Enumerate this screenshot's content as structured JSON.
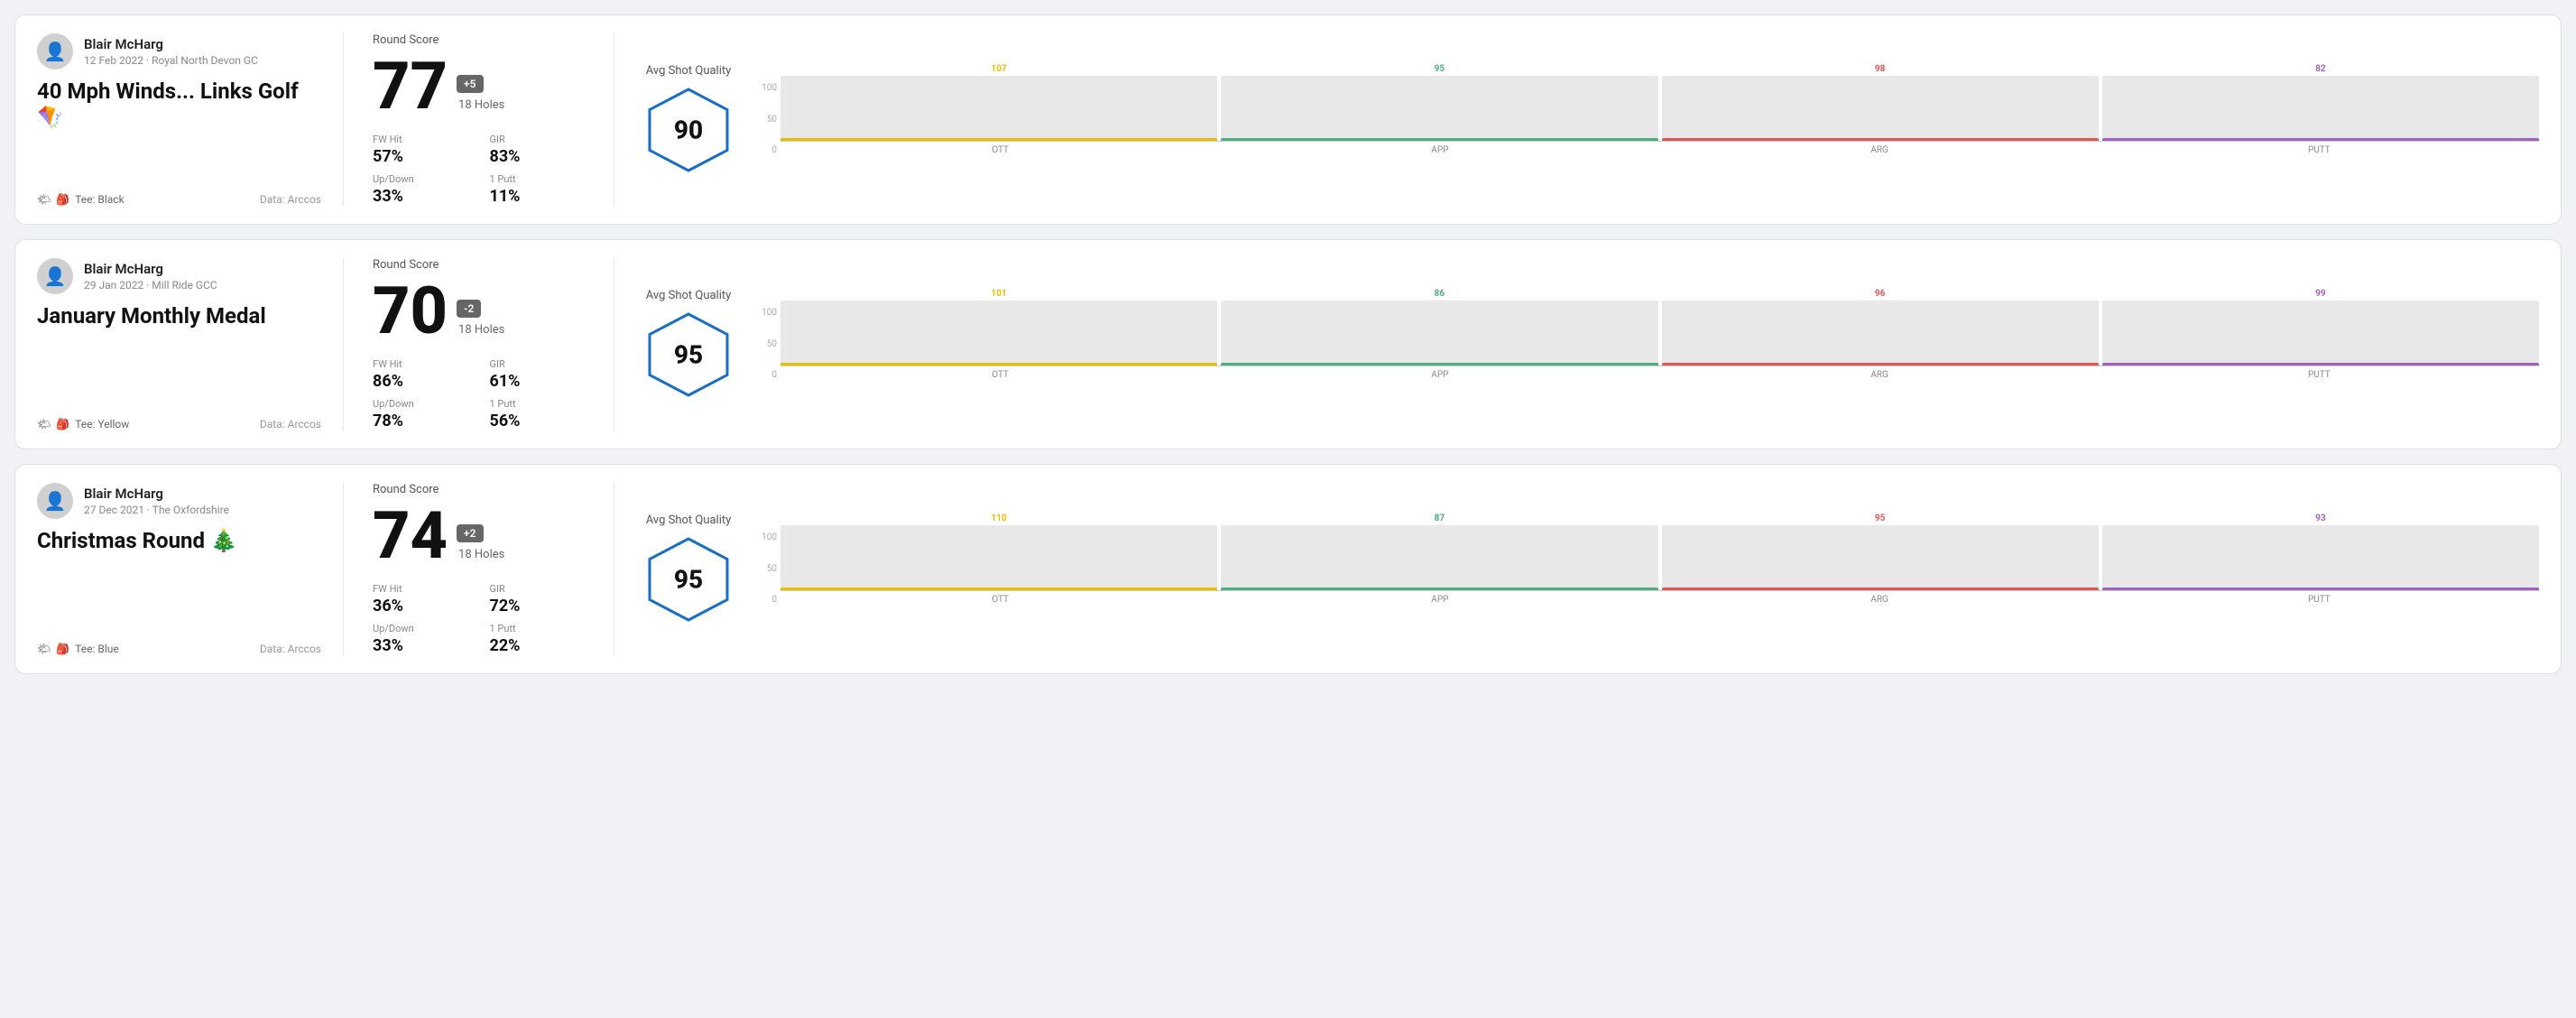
{
  "rounds": [
    {
      "id": "round1",
      "player_name": "Blair McHarg",
      "date_course": "12 Feb 2022 · Royal North Devon GC",
      "title": "40 Mph Winds... Links Golf 🪁",
      "tee": "Black",
      "data_source": "Data: Arccos",
      "round_score_label": "Round Score",
      "score": "77",
      "score_diff": "+5",
      "holes": "18 Holes",
      "fw_hit_label": "FW Hit",
      "fw_hit_value": "57%",
      "gir_label": "GIR",
      "gir_value": "83%",
      "updown_label": "Up/Down",
      "updown_value": "33%",
      "oneputt_label": "1 Putt",
      "oneputt_value": "11%",
      "avg_shot_quality_label": "Avg Shot Quality",
      "quality_score": "90",
      "chart": {
        "ott": {
          "value": 107,
          "color": "#e6c000",
          "height_pct": 78
        },
        "app": {
          "value": 95,
          "color": "#4caf7d",
          "height_pct": 68
        },
        "arg": {
          "value": 98,
          "color": "#e05555",
          "height_pct": 70
        },
        "putt": {
          "value": 82,
          "color": "#a060c0",
          "height_pct": 58
        }
      },
      "chart_y_labels": [
        "100",
        "50",
        "0"
      ]
    },
    {
      "id": "round2",
      "player_name": "Blair McHarg",
      "date_course": "29 Jan 2022 · Mill Ride GCC",
      "title": "January Monthly Medal",
      "tee": "Yellow",
      "data_source": "Data: Arccos",
      "round_score_label": "Round Score",
      "score": "70",
      "score_diff": "-2",
      "holes": "18 Holes",
      "fw_hit_label": "FW Hit",
      "fw_hit_value": "86%",
      "gir_label": "GIR",
      "gir_value": "61%",
      "updown_label": "Up/Down",
      "updown_value": "78%",
      "oneputt_label": "1 Putt",
      "oneputt_value": "56%",
      "avg_shot_quality_label": "Avg Shot Quality",
      "quality_score": "95",
      "chart": {
        "ott": {
          "value": 101,
          "color": "#e6c000",
          "height_pct": 75
        },
        "app": {
          "value": 86,
          "color": "#4caf7d",
          "height_pct": 62
        },
        "arg": {
          "value": 96,
          "color": "#e05555",
          "height_pct": 70
        },
        "putt": {
          "value": 99,
          "color": "#a060c0",
          "height_pct": 73
        }
      },
      "chart_y_labels": [
        "100",
        "50",
        "0"
      ]
    },
    {
      "id": "round3",
      "player_name": "Blair McHarg",
      "date_course": "27 Dec 2021 · The Oxfordshire",
      "title": "Christmas Round 🎄",
      "tee": "Blue",
      "data_source": "Data: Arccos",
      "round_score_label": "Round Score",
      "score": "74",
      "score_diff": "+2",
      "holes": "18 Holes",
      "fw_hit_label": "FW Hit",
      "fw_hit_value": "36%",
      "gir_label": "GIR",
      "gir_value": "72%",
      "updown_label": "Up/Down",
      "updown_value": "33%",
      "oneputt_label": "1 Putt",
      "oneputt_value": "22%",
      "avg_shot_quality_label": "Avg Shot Quality",
      "quality_score": "95",
      "chart": {
        "ott": {
          "value": 110,
          "color": "#e6c000",
          "height_pct": 82
        },
        "app": {
          "value": 87,
          "color": "#4caf7d",
          "height_pct": 63
        },
        "arg": {
          "value": 95,
          "color": "#e05555",
          "height_pct": 70
        },
        "putt": {
          "value": 93,
          "color": "#a060c0",
          "height_pct": 68
        }
      },
      "chart_y_labels": [
        "100",
        "50",
        "0"
      ]
    }
  ],
  "chart_x_labels": [
    "OTT",
    "APP",
    "ARG",
    "PUTT"
  ]
}
